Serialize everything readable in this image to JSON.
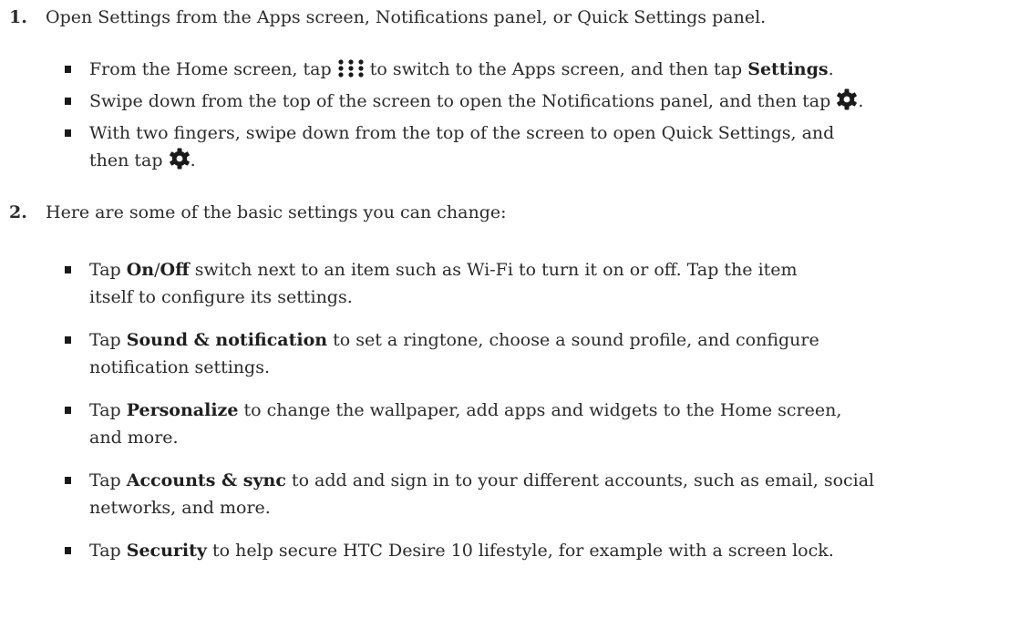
{
  "steps": [
    {
      "number": "1.",
      "text": "Open Settings from the Apps screen, Notifications panel, or Quick Settings panel.",
      "bullets": [
        {
          "part1": "From the Home screen, tap",
          "icon": "apps-grid-icon",
          "part2": "to switch to the Apps screen, and then tap",
          "bold1": "Settings",
          "part3": "."
        },
        {
          "part1": "Swipe down from the top of the screen to open the Notifications panel, and then tap",
          "icon": "settings-gear-icon",
          "part2": "."
        },
        {
          "line1": "With two fingers, swipe down from the top of the screen to open Quick Settings, and",
          "line2_part1": "then tap",
          "icon": "settings-gear-icon",
          "line2_part2": "."
        }
      ]
    },
    {
      "number": "2.",
      "text": "Here are some of the basic settings you can change:",
      "bullets": [
        {
          "pre": "Tap ",
          "bold1": "On",
          "slash": "/",
          "bold2": "Off",
          "line1_rest": " switch next to an item such as Wi-Fi to turn it on or off. Tap the item",
          "line2": "itself to configure its settings."
        },
        {
          "pre": "Tap ",
          "bold1": "Sound & notification",
          "line1_rest": " to set a ringtone, choose a sound profile, and configure",
          "line2": "notification settings."
        },
        {
          "pre": "Tap ",
          "bold1": "Personalize",
          "line1_rest": " to change the wallpaper, add apps and widgets to the Home screen,",
          "line2": "and more."
        },
        {
          "pre": "Tap ",
          "bold1": "Accounts & sync",
          "line1_rest": " to add and sign in to your different accounts, such as email, social",
          "line2": "networks, and more."
        },
        {
          "pre": "Tap ",
          "bold1": "Security",
          "line1_rest": " to help secure HTC Desire 10 lifestyle, for example with a screen lock."
        }
      ]
    }
  ]
}
